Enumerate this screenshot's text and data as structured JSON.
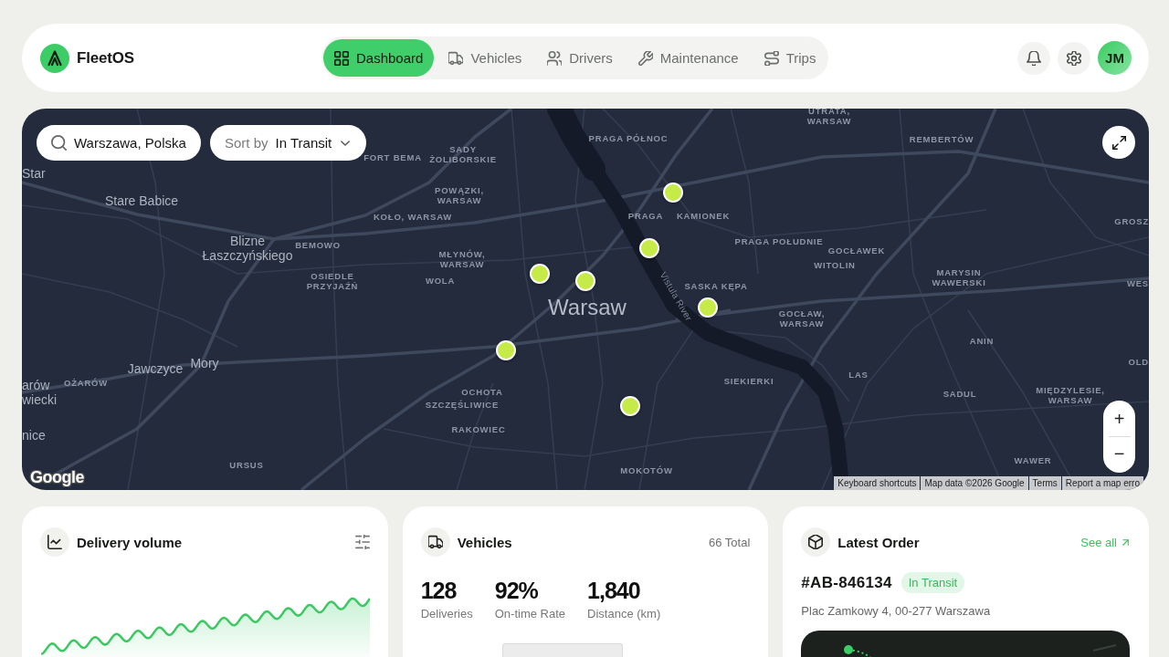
{
  "header": {
    "app_name": "FleetOS",
    "nav": [
      {
        "label": "Dashboard",
        "selected": true
      },
      {
        "label": "Vehicles",
        "selected": false
      },
      {
        "label": "Drivers",
        "selected": false
      },
      {
        "label": "Maintenance",
        "selected": false
      },
      {
        "label": "Trips",
        "selected": false
      }
    ],
    "avatar": "JM"
  },
  "map": {
    "search": {
      "value": "Warszawa, Polska"
    },
    "sort": {
      "label": "Sort by",
      "value": "In Transit"
    },
    "labels": [
      {
        "text": "Star",
        "kind": "town"
      },
      {
        "text": "FORT BEMA",
        "kind": "district"
      },
      {
        "text": "SADY ŻOLIBORSKIE",
        "kind": "district"
      },
      {
        "text": "Stare Babice",
        "kind": "town"
      },
      {
        "text": "POWĄZKI, WARSAW",
        "kind": "district"
      },
      {
        "text": "KOŁO, WARSAW",
        "kind": "district"
      },
      {
        "text": "Blizne Łaszczyńskiego",
        "kind": "town"
      },
      {
        "text": "BEMOWO",
        "kind": "district"
      },
      {
        "text": "MŁYNÓW, WARSAW",
        "kind": "district"
      },
      {
        "text": "OSIEDLE PRZYJAŹŃ",
        "kind": "district"
      },
      {
        "text": "WOLA",
        "kind": "district"
      },
      {
        "text": "Warsaw",
        "kind": "city"
      },
      {
        "text": "UTRATA, WARSAW",
        "kind": "district"
      },
      {
        "text": "PRAGA PÓŁNOC",
        "kind": "district"
      },
      {
        "text": "REMBERTÓW",
        "kind": "district"
      },
      {
        "text": "PRAGA",
        "kind": "district"
      },
      {
        "text": "KAMIONEK",
        "kind": "district"
      },
      {
        "text": "GROSZ",
        "kind": "district"
      },
      {
        "text": "PRAGA POŁUDNIE",
        "kind": "district"
      },
      {
        "text": "GOCŁAWEK",
        "kind": "district"
      },
      {
        "text": "WITOLIN",
        "kind": "district"
      },
      {
        "text": "MARYSIN WAWERSKI",
        "kind": "district"
      },
      {
        "text": "SASKA KĘPA",
        "kind": "district"
      },
      {
        "text": "WES",
        "kind": "district"
      },
      {
        "text": "Vistula River",
        "kind": "river"
      },
      {
        "text": "Jawczyce",
        "kind": "town"
      },
      {
        "text": "Mory",
        "kind": "town"
      },
      {
        "text": "arów wiecki",
        "kind": "town"
      },
      {
        "text": "OŻARÓW",
        "kind": "district"
      },
      {
        "text": "nice",
        "kind": "town"
      },
      {
        "text": "OCHOTA",
        "kind": "district"
      },
      {
        "text": "SZCZĘŚLIWICE",
        "kind": "district"
      },
      {
        "text": "RAKOWIEC",
        "kind": "district"
      },
      {
        "text": "URSUS",
        "kind": "district"
      },
      {
        "text": "GOCŁAW, WARSAW",
        "kind": "district"
      },
      {
        "text": "ANIN",
        "kind": "district"
      },
      {
        "text": "OLD",
        "kind": "district"
      },
      {
        "text": "SIEKIERKI",
        "kind": "district"
      },
      {
        "text": "LAS",
        "kind": "district"
      },
      {
        "text": "SADUL",
        "kind": "district"
      },
      {
        "text": "MIĘDZYLESIE, WARSAW",
        "kind": "district"
      },
      {
        "text": "WAWER",
        "kind": "district"
      },
      {
        "text": "MOKOTÓW",
        "kind": "district"
      }
    ],
    "zoom_controls": [
      "+",
      "−"
    ],
    "logo": "Google",
    "attribution": [
      "Keyboard shortcuts",
      "Map data ©2026 Google",
      "Terms",
      "Report a map erro"
    ]
  },
  "cards": {
    "delivery_volume": {
      "title": "Delivery volume"
    },
    "vehicles": {
      "title": "Vehicles",
      "total": "66 Total",
      "stats": [
        {
          "value": "128",
          "label": "Deliveries"
        },
        {
          "value": "92%",
          "label": "On-time Rate"
        },
        {
          "value": "1,840",
          "label": "Distance (km)"
        }
      ]
    },
    "latest_order": {
      "title": "Latest Order",
      "link": "See all",
      "order_id": "#AB-846134",
      "status": "In Transit",
      "address": "Plac Zamkowy 4, 00-277 Warszawa"
    }
  }
}
